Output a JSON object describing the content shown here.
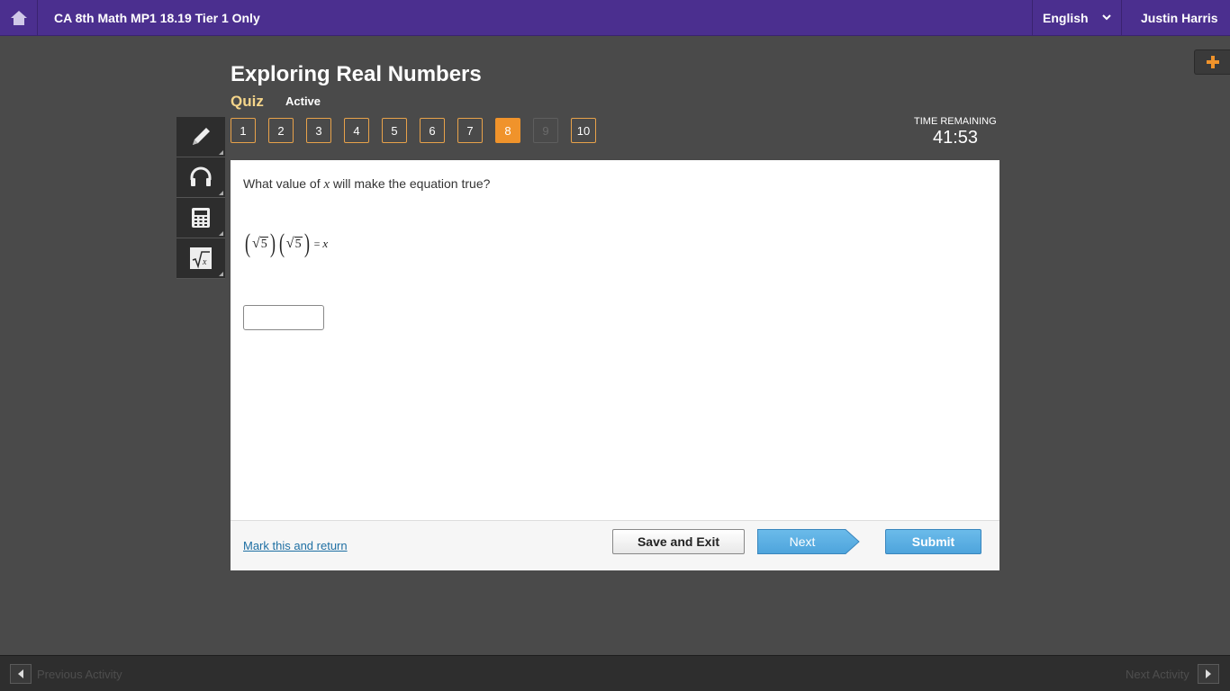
{
  "topbar": {
    "home_icon": "home-icon",
    "course_title": "CA 8th Math MP1 18.19 Tier 1 Only",
    "language": "English",
    "user_name": "Justin Harris"
  },
  "header": {
    "title": "Exploring Real Numbers",
    "type_label": "Quiz",
    "status": "Active"
  },
  "tools": [
    {
      "name": "pencil-icon"
    },
    {
      "name": "headphones-icon"
    },
    {
      "name": "calculator-icon"
    },
    {
      "name": "formula-icon"
    }
  ],
  "question_nav": {
    "labels": [
      "1",
      "2",
      "3",
      "4",
      "5",
      "6",
      "7",
      "8",
      "9",
      "10"
    ],
    "current": "8",
    "disabled": [
      "9"
    ]
  },
  "timer": {
    "label": "TIME REMAINING",
    "value": "41:53"
  },
  "question": {
    "prompt_before": "What value of ",
    "prompt_var": "x",
    "prompt_after": " will make the equation true?",
    "radicand": "5",
    "equals": "=",
    "rhs_var": "x",
    "answer_value": ""
  },
  "footer": {
    "mark_label": "Mark this and return",
    "save_label": "Save and Exit",
    "next_label": "Next",
    "submit_label": "Submit"
  },
  "bottom": {
    "prev_label": "Previous Activity",
    "next_label": "Next Activity"
  },
  "colors": {
    "topbar": "#4b2f8f",
    "background": "#4a4a4a",
    "accent_orange": "#f0932b",
    "quiz_label": "#f5d58a",
    "button_blue": "#4ea4dc"
  }
}
